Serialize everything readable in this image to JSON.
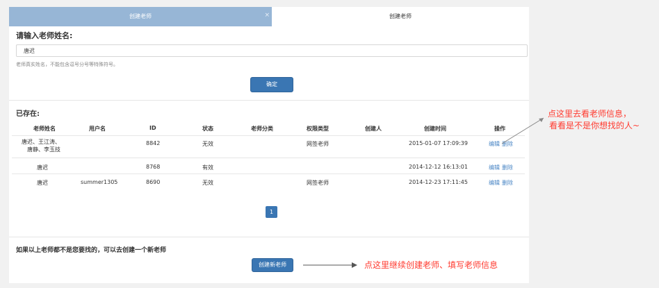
{
  "tabs": [
    {
      "label": "创建老师",
      "active": true,
      "close": "×"
    },
    {
      "label": "创建老师",
      "active": false
    }
  ],
  "form": {
    "title": "请输入老师姓名:",
    "input_value": "唐迟",
    "help": "老师真实姓名，不能包含逗号分号等特殊符号。",
    "confirm_label": "确定"
  },
  "existing": {
    "title": "已存在:",
    "columns": [
      "老师姓名",
      "用户名",
      "ID",
      "状态",
      "老师分类",
      "权限类型",
      "创建人",
      "创建时间",
      "操作"
    ],
    "rows": [
      {
        "name_line1": "唐迟、王江涛、",
        "name_line2": "唐静、李玉技",
        "username": "",
        "id": "8842",
        "status": "无效",
        "category": "",
        "permission": "网签老师",
        "creator": "",
        "created": "2015-01-07 17:09:39",
        "edit": "编辑",
        "delete": "删除"
      },
      {
        "name_line1": "唐迟",
        "name_line2": "",
        "username": "",
        "id": "8768",
        "status": "有效",
        "category": "",
        "permission": "",
        "creator": "",
        "created": "2014-12-12 16:13:01",
        "edit": "编辑",
        "delete": "删除"
      },
      {
        "name_line1": "唐迟",
        "name_line2": "",
        "username": "summer1305",
        "id": "8690",
        "status": "无效",
        "category": "",
        "permission": "网签老师",
        "creator": "",
        "created": "2014-12-23 17:11:45",
        "edit": "编辑",
        "delete": "删除"
      }
    ],
    "page": "1"
  },
  "bottom": {
    "text": "如果以上老师都不是您要找的，可以去创建一个新老师",
    "create_label": "创建新老师"
  },
  "annotations": {
    "top_line1": "点这里去看老师信息，",
    "top_line2": "看看是不是你想找的人~",
    "bottom": "点这里继续创建老师、填写老师信息",
    "color": "#ff3b30"
  }
}
